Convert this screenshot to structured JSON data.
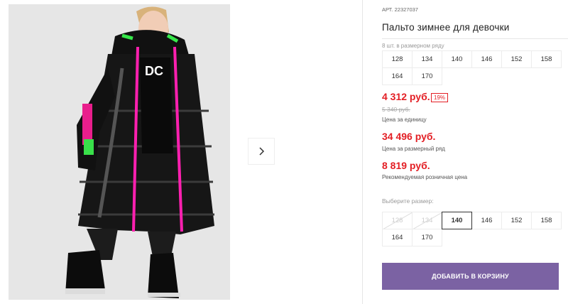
{
  "gallery": {
    "next_icon": "chevron-right-icon",
    "photo_alt": "girl-in-black-winter-coat"
  },
  "product": {
    "article_label": "АРТ.",
    "article_number": "22327037",
    "title": "Пальто зимнее для девочки",
    "series_label": "8 шт. в размерном ряду",
    "series_sizes": [
      "128",
      "134",
      "140",
      "146",
      "152",
      "158",
      "164",
      "170"
    ]
  },
  "prices": {
    "unit_price": "4 312 руб.",
    "discount": "19%",
    "old_price": "5 340 руб.",
    "unit_caption": "Цена за единицу",
    "series_price": "34 496 руб.",
    "series_caption": "Цена за размерный ряд",
    "retail_price": "8 819 руб.",
    "retail_caption": "Рекомендуемая розничная цена",
    "accent_color": "#e31e24"
  },
  "size_picker": {
    "label": "Выберите размер:",
    "sizes": [
      {
        "label": "128",
        "state": "disabled"
      },
      {
        "label": "134",
        "state": "disabled"
      },
      {
        "label": "140",
        "state": "selected"
      },
      {
        "label": "146",
        "state": "available"
      },
      {
        "label": "152",
        "state": "available"
      },
      {
        "label": "158",
        "state": "available"
      },
      {
        "label": "164",
        "state": "available"
      },
      {
        "label": "170",
        "state": "available"
      }
    ]
  },
  "cart": {
    "button_label": "ДОБАВИТЬ В КОРЗИНУ",
    "button_color": "#7b62a3"
  }
}
